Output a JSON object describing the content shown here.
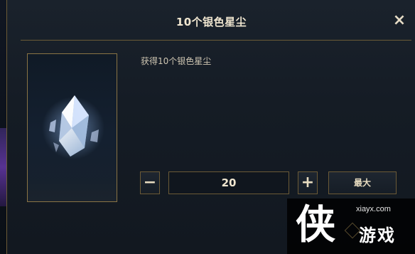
{
  "dialog": {
    "title": "10个银色星尘",
    "close_glyph": "×",
    "description": "获得10个银色星尘",
    "item_icon": "silver-stardust-crystal-icon"
  },
  "quantity": {
    "minus_label": "−",
    "value": "20",
    "plus_label": "+",
    "max_label": "最大"
  },
  "watermark": {
    "logo_char": "侠",
    "url": "xiayx.com",
    "name": "游戏"
  },
  "colors": {
    "gold_border": "#8a7444",
    "text": "#e8dcc0",
    "dialog_bg": "#151c25"
  }
}
